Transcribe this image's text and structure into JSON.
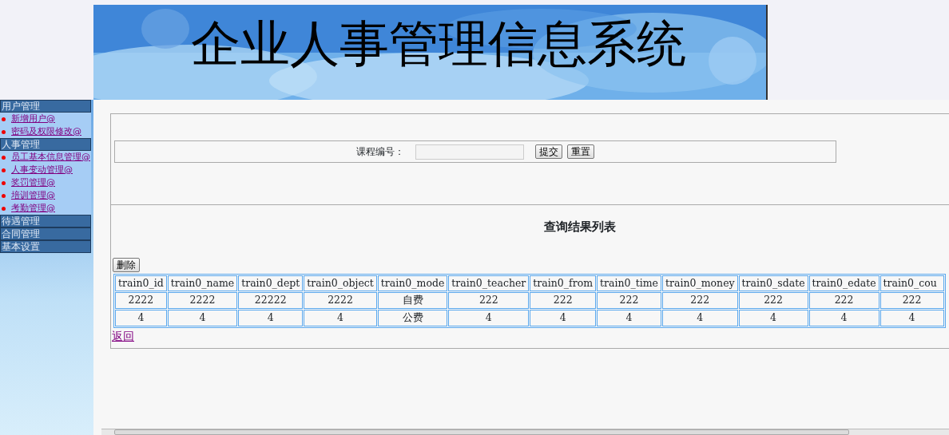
{
  "banner": {
    "title": "企业人事管理信息系统"
  },
  "sidebar": {
    "groups": [
      {
        "label": "用户管理",
        "expanded": true,
        "items": [
          {
            "label": "新增用户@"
          },
          {
            "label": "密码及权限修改@"
          }
        ]
      },
      {
        "label": "人事管理",
        "expanded": true,
        "items": [
          {
            "label": "员工基本信息管理@"
          },
          {
            "label": "人事变动管理@"
          },
          {
            "label": "奖罚管理@"
          },
          {
            "label": "培训管理@"
          },
          {
            "label": "考勤管理@"
          }
        ]
      },
      {
        "label": "待遇管理",
        "expanded": false
      },
      {
        "label": "合同管理",
        "expanded": false
      },
      {
        "label": "基本设置",
        "expanded": false
      }
    ]
  },
  "search": {
    "label": "课程编号：",
    "buttons": [
      "提交",
      "重置"
    ]
  },
  "results": {
    "title": "查询结果列表",
    "delete_button": "删除",
    "table": {
      "columns": [
        "train0_id",
        "train0_name",
        "train0_dept",
        "train0_object",
        "train0_mode",
        "train0_teacher",
        "train0_from",
        "train0_time",
        "train0_money",
        "train0_sdate",
        "train0_edate",
        "train0_cou"
      ],
      "rows": [
        [
          "2222",
          "2222",
          "22222",
          "2222",
          "自费",
          "222",
          "222",
          "222",
          "222",
          "222",
          "222",
          "222"
        ],
        [
          "4",
          "4",
          "4",
          "4",
          "公费",
          "4",
          "4",
          "4",
          "4",
          "4",
          "4",
          "4"
        ]
      ]
    },
    "back_link": "返回"
  }
}
